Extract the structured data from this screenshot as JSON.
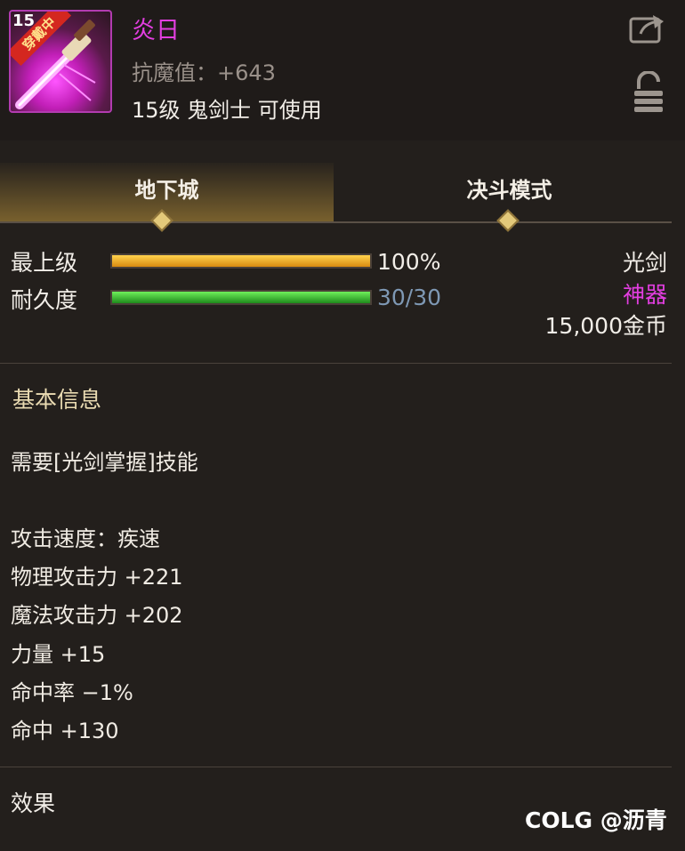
{
  "item": {
    "icon_level": "15",
    "icon_badge": "穿戴中",
    "name": "炎日",
    "resistance": "抗魔值：+643",
    "requirement": "15级 鬼剑士 可使用"
  },
  "tabs": [
    "地下城",
    "决斗模式"
  ],
  "stats": {
    "grade_label": "最上级",
    "grade_value": "100%",
    "grade_fill": 1.0,
    "durability_label": "耐久度",
    "durability_value": "30/30",
    "durability_fill": 1.0
  },
  "info": {
    "type": "光剑",
    "rarity": "神器",
    "price": "15,000金币"
  },
  "colors": {
    "rarity": "#e23ee0",
    "grade_bar": "#f0b020",
    "durability_bar": "#3cc23a",
    "durability_text": "#7e98b4"
  },
  "basic": {
    "title": "基本信息",
    "skill_req": "需要[光剑掌握]技能",
    "lines": [
      "攻击速度：疾速",
      "物理攻击力 +221",
      "魔法攻击力 +202",
      "力量 +15",
      "命中率 −1%",
      "命中 +130"
    ]
  },
  "effect": {
    "title": "效果"
  },
  "watermark": "COLG @沥青"
}
